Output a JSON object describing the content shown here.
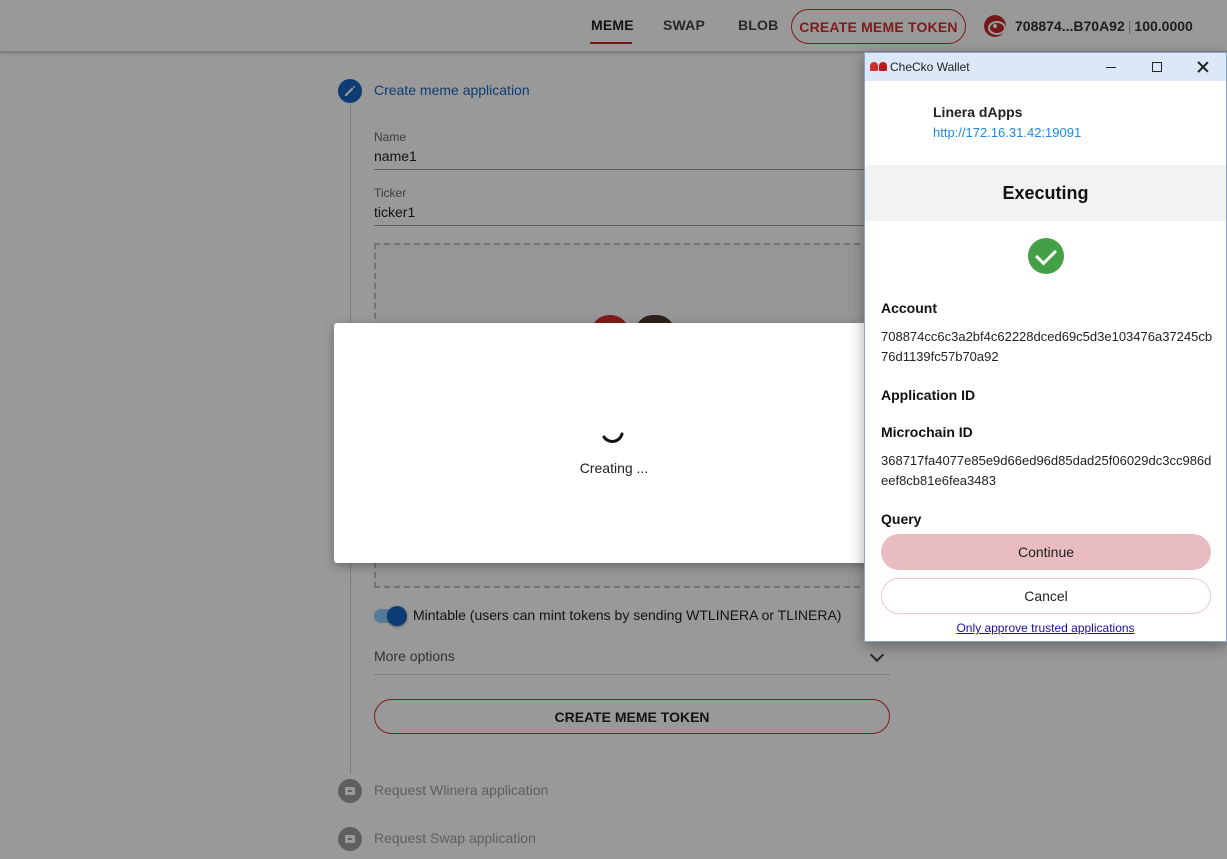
{
  "header": {
    "nav": [
      "MEME",
      "SWAP",
      "BLOB"
    ],
    "active_nav": "MEME",
    "cta_label": "CREATE MEME TOKEN",
    "account_short": "708874...B70A92",
    "balance": "100.0000",
    "accent_color": "#d32f2f"
  },
  "form": {
    "step_title": "Create meme application",
    "name_label": "Name",
    "name_value": "name1",
    "ticker_label": "Ticker",
    "ticker_value": "ticker1",
    "mintable_label": "Mintable (users can mint tokens by sending WTLINERA or TLINERA)",
    "mintable_on": true,
    "more_options_label": "More options",
    "create_button_label": "CREATE MEME TOKEN",
    "next_steps": [
      "Request Wlinera application",
      "Request Swap application"
    ]
  },
  "loading_dialog": {
    "text": "Creating ..."
  },
  "wallet": {
    "window_title": "CheCko Wallet",
    "dapp_name": "Linera dApps",
    "dapp_url": "http://172.16.31.42:19091",
    "status_title": "Executing",
    "account_label": "Account",
    "account_value": "708874cc6c3a2bf4c62228dced69c5d3e103476a37245cb76d1139fc57b70a92",
    "application_id_label": "Application ID",
    "microchain_id_label": "Microchain ID",
    "microchain_id_value": "368717fa4077e85e9d66ed96d85dad25f06029dc3cc986deef8cb81e6fea3483",
    "query_label": "Query",
    "continue_label": "Continue",
    "cancel_label": "Cancel",
    "trust_link": "Only approve trusted applications"
  }
}
